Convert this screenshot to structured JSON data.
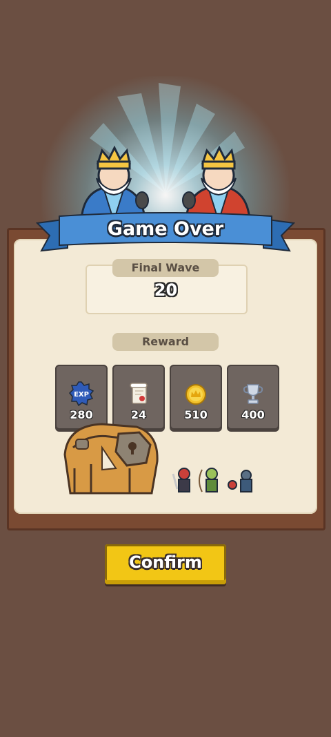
{
  "dialog": {
    "title": "Game Over",
    "final_wave_label": "Final Wave",
    "final_wave_value": "20",
    "reward_label": "Reward"
  },
  "rewards": [
    {
      "icon": "exp-badge-icon",
      "badge_text": "EXP",
      "value": "280"
    },
    {
      "icon": "scroll-icon",
      "value": "24"
    },
    {
      "icon": "gold-coin-icon",
      "value": "510"
    },
    {
      "icon": "trophy-icon",
      "value": "400"
    }
  ],
  "confirm_label": "Confirm",
  "colors": {
    "background": "#6b4f42",
    "panel_frame": "#7a4a32",
    "panel_inner": "#f3ead6",
    "ribbon_blue": "#3f86cf",
    "tile": "#6f6560",
    "confirm_yellow": "#f2c615"
  }
}
